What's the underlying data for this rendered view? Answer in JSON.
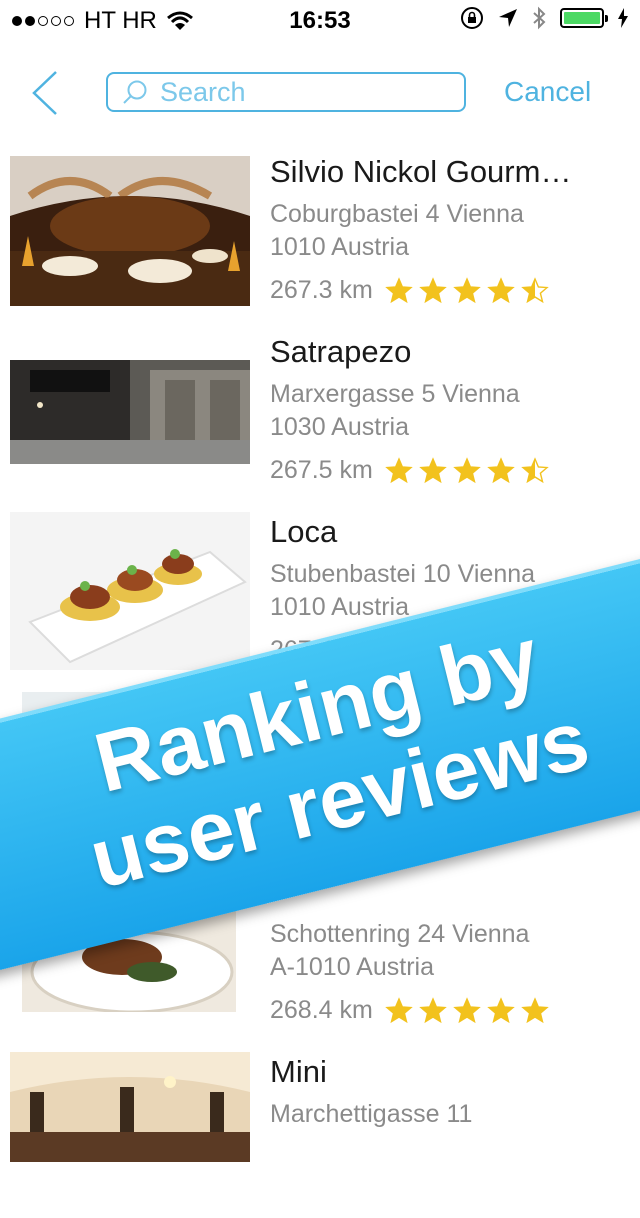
{
  "status_bar": {
    "carrier": "HT HR",
    "time": "16:53",
    "signal_full": 2,
    "signal_total": 5,
    "battery_level": 0.95
  },
  "nav": {
    "search_placeholder": "Search",
    "cancel_label": "Cancel"
  },
  "restaurants": [
    {
      "name": "Silvio Nickol Gourm…",
      "address_line1": "Coburgbastei 4 Vienna",
      "address_line2": "1010 Austria",
      "distance": "267.3 km",
      "rating": 4.5
    },
    {
      "name": "Satrapezo",
      "address_line1": "Marxergasse 5 Vienna",
      "address_line2": "1030 Austria",
      "distance": "267.5 km",
      "rating": 4.5
    },
    {
      "name": "Loca",
      "address_line1": "Stubenbastei 10 Vienna",
      "address_line2": "1010 Austria",
      "distance": "267.4 km",
      "rating": 4.5
    },
    {
      "name": "",
      "address_line1": "Schottenring 24 Vienna",
      "address_line2": "A-1010 Austria",
      "distance": "268.4 km",
      "rating": 5
    },
    {
      "name": "Mini",
      "address_line1": "Marchettigasse 11",
      "address_line2": "",
      "distance": "",
      "rating": 0
    }
  ],
  "banner": {
    "line1": "Ranking by",
    "line2": "user reviews"
  },
  "colors": {
    "accent": "#4fb3e0",
    "star": "#f2c21d",
    "banner": "#29b2f0"
  }
}
